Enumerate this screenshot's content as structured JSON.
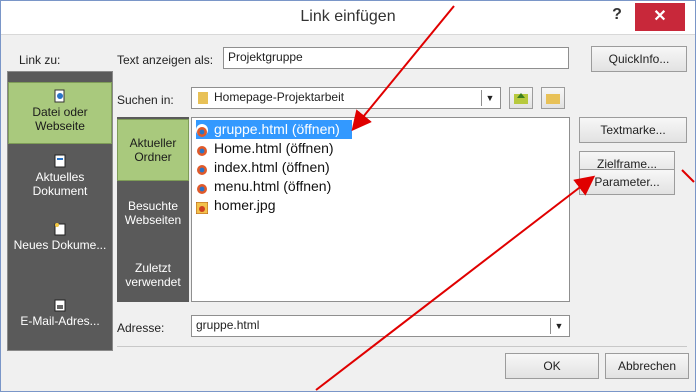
{
  "dialog": {
    "title": "Link einfügen"
  },
  "link_to": {
    "label": "Link zu:",
    "items": [
      {
        "label": "Datei oder Webseite",
        "icon": "page-globe-icon",
        "selected": true
      },
      {
        "label": "Aktuelles Dokument",
        "icon": "document-icon"
      },
      {
        "label": "Neues Dokume...",
        "icon": "new-document-icon"
      },
      {
        "label": "E-Mail-Adres...",
        "icon": "email-icon"
      }
    ]
  },
  "text_display": {
    "label": "Text anzeigen als:",
    "value": "Projektgruppe"
  },
  "search_in": {
    "label": "Suchen in:",
    "value": "Homepage-Projektarbeit"
  },
  "buttons": {
    "quickinfo": "QuickInfo...",
    "textmarke": "Textmarke...",
    "zielframe": "Zielframe...",
    "parameter": "Parameter...",
    "ok": "OK",
    "abbrechen": "Abbrechen"
  },
  "browse_tabs": [
    {
      "label": "Aktueller Ordner",
      "selected": true
    },
    {
      "label": "Besuchte Webseiten"
    },
    {
      "label": "Zuletzt verwendet"
    }
  ],
  "files": [
    {
      "name": "gruppe.html (öffnen)",
      "selected": true,
      "icon": "html-file-icon"
    },
    {
      "name": "Home.html (öffnen)",
      "icon": "html-file-icon"
    },
    {
      "name": "index.html (öffnen)",
      "icon": "html-file-icon"
    },
    {
      "name": "menu.html (öffnen)",
      "icon": "html-file-icon"
    },
    {
      "name": "homer.jpg",
      "icon": "jpg-file-icon"
    }
  ],
  "address": {
    "label": "Adresse:",
    "value": "gruppe.html"
  },
  "colors": {
    "accent_green": "#a9c97d",
    "selection_blue": "#3399ff",
    "close_red": "#c8283a",
    "arrow_red": "#e00000"
  }
}
